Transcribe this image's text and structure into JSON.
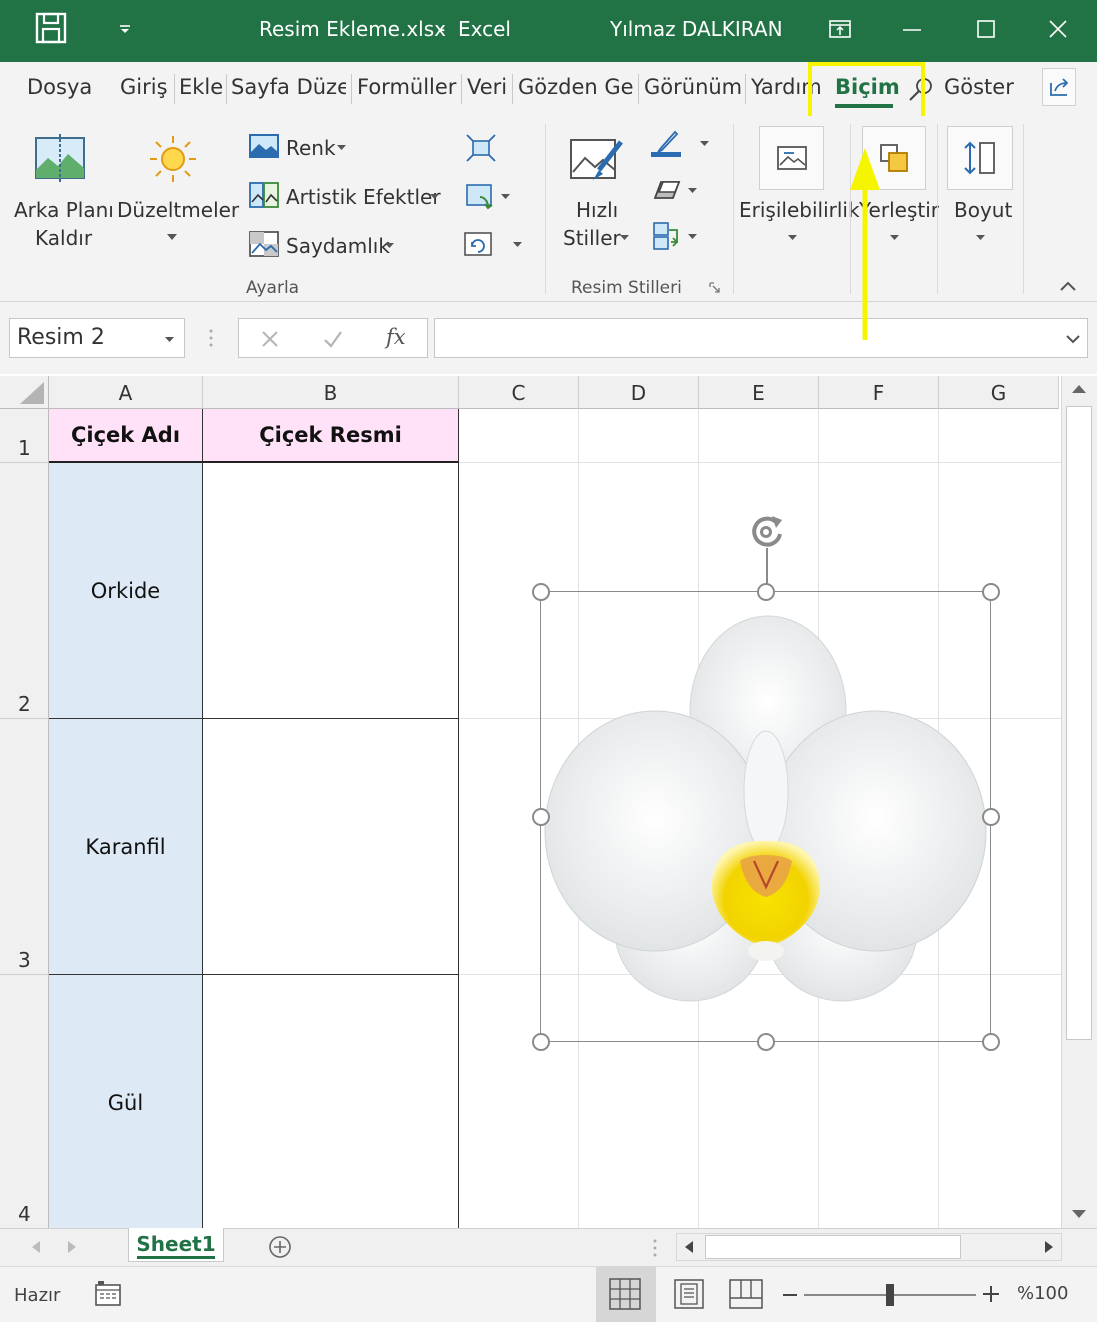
{
  "titlebar": {
    "filename": "Resim Ekleme.xlsx",
    "separator": "-",
    "app": "Excel",
    "user": "Yılmaz DALKIRAN"
  },
  "tabs": [
    "Dosya",
    "Giriş",
    "Ekle",
    "Sayfa Düzeı",
    "Formüller",
    "Veri",
    "Gözden Geı",
    "Görünüm",
    "Yardım",
    "Biçim",
    "Göster"
  ],
  "ribbon": {
    "remove_bg_line1": "Arka Planı",
    "remove_bg_line2": "Kaldır",
    "corrections": "Düzeltmeler",
    "color": "Renk",
    "artistic": "Artistik Efektler",
    "transparency": "Saydamlık",
    "group_adjust": "Ayarla",
    "quick_styles_line1": "Hızlı",
    "quick_styles_line2": "Stiller",
    "group_styles": "Resim Stilleri",
    "accessibility": "Erişilebilirlik",
    "arrange": "Yerleştir",
    "size": "Boyut"
  },
  "formula_bar": {
    "name_box": "Resim 2",
    "fx": "fx",
    "formula": ""
  },
  "columns": [
    "A",
    "B",
    "C",
    "D",
    "E",
    "F",
    "G"
  ],
  "rows": [
    "1",
    "2",
    "3",
    "4"
  ],
  "table": {
    "header_a": "Çiçek Adı",
    "header_b": "Çiçek Resmi",
    "names": [
      "Orkide",
      "Karanfil",
      "Gül"
    ]
  },
  "sheet": {
    "tab": "Sheet1"
  },
  "status": {
    "ready": "Hazır",
    "zoom": "%100"
  },
  "colors": {
    "excel_green": "#217346",
    "header_pink": "#ffe1f8",
    "name_blue": "#ddeaf6",
    "highlight_yellow": "#f5f500"
  }
}
